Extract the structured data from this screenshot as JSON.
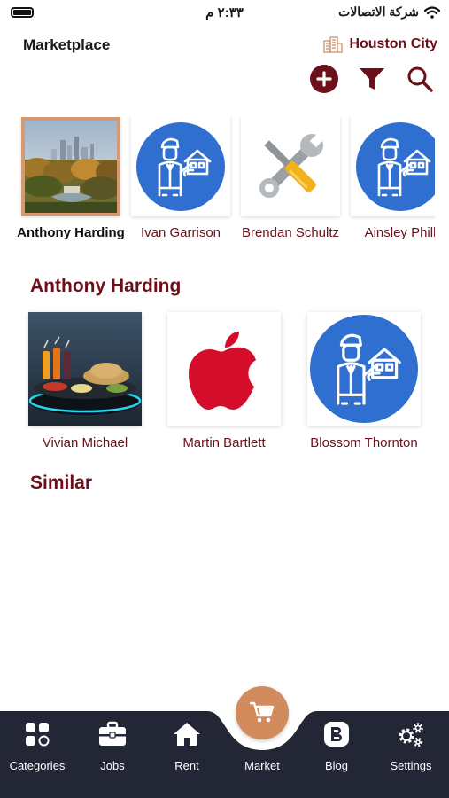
{
  "status": {
    "time": "٢:٣٣ م",
    "carrier": "شركة الاتصالات"
  },
  "header": {
    "title": "Marketplace",
    "city": "Houston City"
  },
  "carousel": [
    {
      "label": "Anthony Harding",
      "icon": "city-photo",
      "selected": true
    },
    {
      "label": "Ivan Garrison",
      "icon": "agent-icon",
      "selected": false
    },
    {
      "label": "Brendan Schultz",
      "icon": "tools-icon",
      "selected": false
    },
    {
      "label": "Ainsley Phill",
      "icon": "agent-icon",
      "selected": false
    }
  ],
  "section": {
    "title": "Anthony Harding",
    "similar": "Similar"
  },
  "items": [
    {
      "label": "Vivian Michael",
      "icon": "food-photo"
    },
    {
      "label": "Martin Bartlett",
      "icon": "apple-logo"
    },
    {
      "label": "Blossom Thornton",
      "icon": "agent-icon"
    }
  ],
  "nav": [
    {
      "label": "Categories",
      "icon": "categories-icon"
    },
    {
      "label": "Jobs",
      "icon": "briefcase-icon"
    },
    {
      "label": "Rent",
      "icon": "home-icon"
    },
    {
      "label": "Market",
      "icon": "cart-icon",
      "active": true
    },
    {
      "label": "Blog",
      "icon": "blog-icon"
    },
    {
      "label": "Settings",
      "icon": "gears-icon"
    }
  ],
  "colors": {
    "brand": "#6b0f1a",
    "nav_bg": "#232634",
    "accent": "#d18b5d",
    "agent_blue": "#2f6fd0"
  }
}
